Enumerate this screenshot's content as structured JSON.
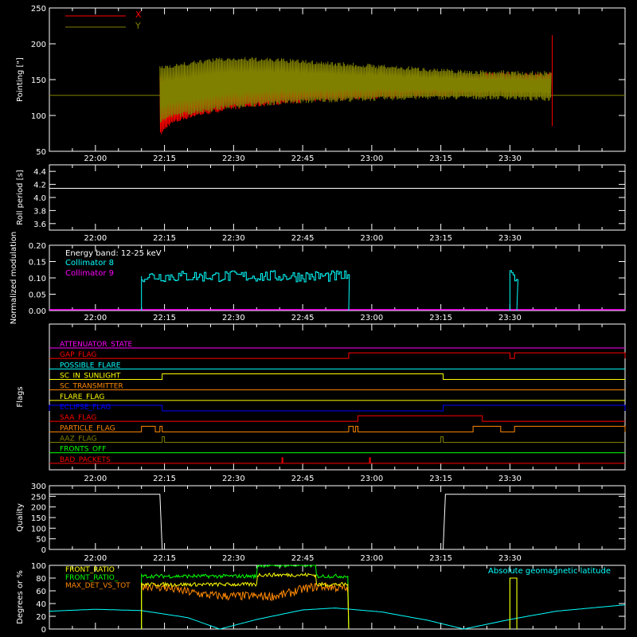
{
  "colors": {
    "frame": "#ffffff",
    "x": "#ff0000",
    "y": "#808000",
    "cyan": "#00ffff",
    "magenta": "#ff00ff",
    "red": "#ff0000",
    "orange": "#ff8800",
    "yellow": "#ffff00",
    "green": "#00ff00",
    "blue": "#0000ff",
    "olive": "#808000"
  },
  "time_ticks": [
    "22:00",
    "22:15",
    "22:30",
    "22:45",
    "23:00",
    "23:15",
    "23:30"
  ],
  "chart_data": [
    {
      "type": "line",
      "ylabel": "Pointing [\"]",
      "ylim": [
        50,
        250
      ],
      "yticks": [
        "50",
        "100",
        "150",
        "200",
        "250"
      ],
      "xlim_min": [
        -10,
        115
      ],
      "legend": {
        "placement": "top-left"
      },
      "series": [
        {
          "name": "X",
          "color_key": "x",
          "envelope_t": [
            14,
            16,
            20,
            25,
            30,
            40,
            50,
            60,
            70,
            80,
            85,
            90,
            95,
            99
          ],
          "upper": [
            155,
            150,
            150,
            148,
            147,
            147,
            148,
            150,
            153,
            157,
            160,
            160,
            160,
            160
          ],
          "lower": [
            70,
            85,
            95,
            102,
            108,
            115,
            120,
            123,
            125,
            127,
            128,
            128,
            130,
            130
          ]
        },
        {
          "name": "Y",
          "color_key": "y",
          "envelope_t": [
            14,
            16,
            20,
            25,
            30,
            40,
            50,
            60,
            70,
            80,
            85,
            90,
            95,
            99
          ],
          "upper": [
            170,
            172,
            175,
            180,
            182,
            180,
            176,
            172,
            168,
            164,
            163,
            163,
            162,
            162
          ],
          "lower": [
            88,
            95,
            100,
            105,
            110,
            115,
            118,
            120,
            122,
            122,
            122,
            122,
            120,
            120
          ]
        }
      ],
      "baseline": 128
    },
    {
      "type": "line",
      "ylabel": "Roll period [s]",
      "ylim": [
        3.5,
        4.5
      ],
      "yticks": [
        "3.6",
        "3.8",
        "4.0",
        "4.2",
        "4.4"
      ],
      "series": [
        {
          "name": "",
          "color_key": "frame",
          "x": [
            -10,
            115
          ],
          "y": [
            4.14,
            4.14
          ]
        }
      ]
    },
    {
      "type": "line",
      "ylabel": "Normalized modulation",
      "ylim": [
        0.0,
        0.2
      ],
      "yticks": [
        "0.00",
        "0.05",
        "0.10",
        "0.15",
        "0.20"
      ],
      "legend_title": "Energy band: 12-25 keV",
      "series": [
        {
          "name": "Collimator 8",
          "color_key": "cyan",
          "segments": [
            [
              10,
              55,
              0.105
            ],
            [
              90,
              91.5,
              0.105
            ]
          ]
        },
        {
          "name": "Collimator 9",
          "color_key": "magenta",
          "x": [
            -10,
            115
          ],
          "y": [
            0,
            0
          ]
        }
      ]
    },
    {
      "type": "line",
      "ylabel": "Flags",
      "flags": [
        {
          "name": "ATTENUATOR_STATE",
          "color_key": "magenta",
          "steps": []
        },
        {
          "name": "GAP_FLAG",
          "color_key": "red",
          "steps": [
            [
              55,
              90
            ],
            [
              91,
              115
            ]
          ]
        },
        {
          "name": "POSSIBLE_FLARE",
          "color_key": "cyan",
          "steps": []
        },
        {
          "name": "SC_IN_SUNLIGHT",
          "color_key": "yellow",
          "steps": [
            [
              14.5,
              75.5
            ]
          ]
        },
        {
          "name": "SC_TRANSMITTER",
          "color_key": "orange",
          "steps": []
        },
        {
          "name": "FLARE_FLAG",
          "color_key": "yellow",
          "steps": []
        },
        {
          "name": "ECLIPSE_FLAG",
          "color_key": "blue",
          "steps": [
            [
              -10,
              14.5
            ],
            [
              75.5,
              115
            ]
          ]
        },
        {
          "name": "SAA_FLAG",
          "color_key": "red",
          "steps": [
            [
              57,
              84
            ]
          ]
        },
        {
          "name": "PARTICLE_FLAG",
          "color_key": "orange",
          "steps": [
            [
              10,
              13
            ],
            [
              14,
              14.5
            ],
            [
              55,
              56
            ],
            [
              56.5,
              57
            ],
            [
              82,
              88
            ],
            [
              91,
              115
            ]
          ]
        },
        {
          "name": "AAZ_FLAG",
          "color_key": "olive",
          "steps": [
            [
              14.5,
              15
            ],
            [
              75,
              75.5
            ]
          ]
        },
        {
          "name": "FRONTS_OFF",
          "color_key": "green",
          "steps": []
        },
        {
          "name": "BAD_PACKETS",
          "color_key": "red",
          "steps": [
            [
              40.5,
              40.7
            ],
            [
              59.5,
              59.7
            ]
          ]
        }
      ]
    },
    {
      "type": "line",
      "ylabel": "Quality",
      "ylim": [
        0,
        300
      ],
      "yticks": [
        "0",
        "50",
        "100",
        "150",
        "200",
        "250",
        "300"
      ],
      "series": [
        {
          "name": "",
          "color_key": "frame",
          "x": [
            -10,
            14,
            14.5,
            75.5,
            76,
            115
          ],
          "y": [
            260,
            260,
            0,
            0,
            260,
            260
          ]
        }
      ]
    },
    {
      "type": "line",
      "ylabel": "Degrees or %",
      "ylim": [
        0,
        100
      ],
      "yticks": [
        "0",
        "20",
        "40",
        "60",
        "80",
        "100"
      ],
      "annotation": "Absolute geomagnetic latitude",
      "series": [
        {
          "name": "FRONT_RATIO",
          "color_key": "yellow",
          "segments": [
            [
              10,
              55,
              70
            ]
          ],
          "bumps": [
            [
              35,
              48,
              85
            ]
          ]
        },
        {
          "name": "FRONT_RATIO_",
          "color_key": "green",
          "segments": [
            [
              10,
              55,
              83
            ]
          ],
          "bumps": [
            [
              35,
              48,
              100
            ]
          ]
        },
        {
          "name": "MAX_DET_VS_TOT",
          "color_key": "orange",
          "segments": [
            [
              10,
              55,
              60
            ]
          ]
        },
        {
          "name": "",
          "color_key": "cyan",
          "x": [
            -10,
            0,
            10,
            20,
            27,
            35,
            45,
            52,
            62,
            72,
            80,
            90,
            100,
            115
          ],
          "y": [
            28,
            31,
            29,
            18,
            0,
            15,
            30,
            33,
            27,
            14,
            0,
            15,
            28,
            38
          ]
        }
      ]
    }
  ]
}
